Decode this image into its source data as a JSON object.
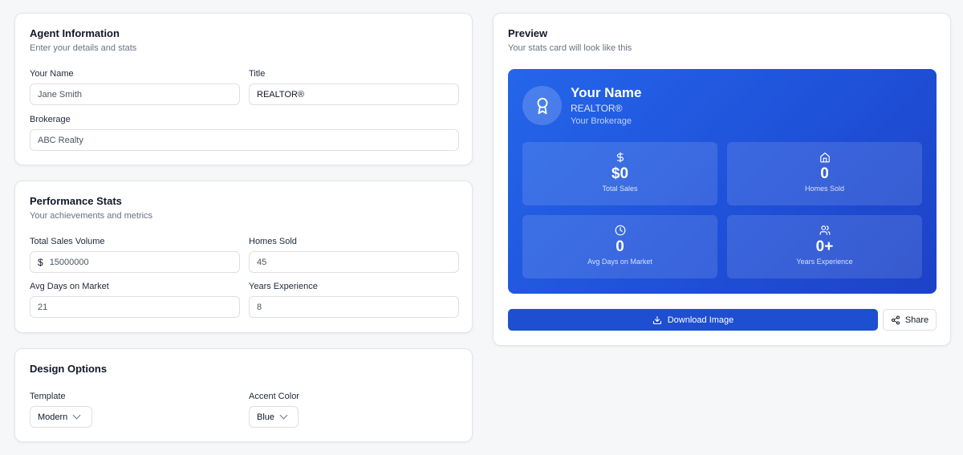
{
  "agent_info": {
    "title": "Agent Information",
    "subtitle": "Enter your details and stats",
    "name_label": "Your Name",
    "name_placeholder": "Jane Smith",
    "title_label": "Title",
    "title_value": "REALTOR®",
    "brokerage_label": "Brokerage",
    "brokerage_placeholder": "ABC Realty"
  },
  "performance": {
    "title": "Performance Stats",
    "subtitle": "Your achievements and metrics",
    "sales_label": "Total Sales Volume",
    "sales_prefix": "$",
    "sales_placeholder": "15000000",
    "homes_label": "Homes Sold",
    "homes_placeholder": "45",
    "days_label": "Avg Days on Market",
    "days_placeholder": "21",
    "years_label": "Years Experience",
    "years_placeholder": "8"
  },
  "design": {
    "title": "Design Options",
    "template_label": "Template",
    "template_value": "Modern",
    "accent_label": "Accent Color",
    "accent_value": "Blue"
  },
  "preview": {
    "title": "Preview",
    "subtitle": "Your stats card will look like this",
    "card": {
      "name": "Your Name",
      "title": "REALTOR®",
      "brokerage": "Your Brokerage",
      "stats": [
        {
          "icon": "dollar-icon",
          "value": "$0",
          "label": "Total Sales"
        },
        {
          "icon": "home-icon",
          "value": "0",
          "label": "Homes Sold"
        },
        {
          "icon": "clock-icon",
          "value": "0",
          "label": "Avg Days on Market"
        },
        {
          "icon": "users-icon",
          "value": "0+",
          "label": "Years Experience"
        }
      ]
    },
    "download_label": "Download Image",
    "share_label": "Share"
  },
  "colors": {
    "accent": "#1d4fd0",
    "card_gradient_start": "#2466ea",
    "card_gradient_end": "#1d42c6"
  }
}
